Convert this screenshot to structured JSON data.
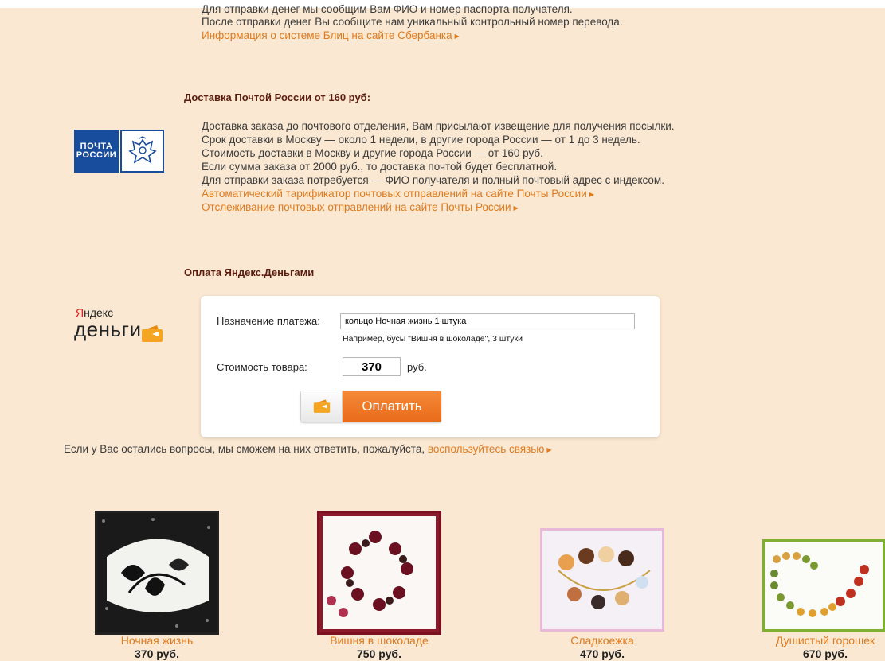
{
  "blitz": {
    "line1": "Для отправки денег мы сообщим Вам ФИО и номер паспорта получателя.",
    "line2": "После отправки денег Вы сообщите нам уникальный контрольный номер перевода.",
    "link": "Информация о системе Блиц на сайте Сбербанка"
  },
  "post": {
    "title": "Доставка Почтой России от 160 руб:",
    "logo_line1": "ПОЧТА",
    "logo_line2": "РОССИИ",
    "lines": [
      "Доставка заказа до почтового отделения, Вам присылают извещение для получения посылки.",
      "Срок доставки в Москву — около 1 недели, в другие города России — от 1 до 3 недель.",
      "Стоимость доставки в Москву и другие города России — от 160 руб.",
      "Если сумма заказа от 2000 руб., то доставка почтой будет бесплатной.",
      "Для отправки заказа потребуется — ФИО получателя и полный почтовый адрес с индексом."
    ],
    "link1": "Автоматический тарификатор почтовых отправлений на сайте Почты России",
    "link2": "Отслеживание почтовых отправлений на сайте Почты России"
  },
  "yandex": {
    "title": "Оплата Яндекс.Деньгами",
    "logo_y": "Я",
    "logo_rest": "ндекс",
    "logo_money": "деньги",
    "purpose_label": "Назначение платежа:",
    "purpose_value": "кольцо Ночная жизнь 1 штука",
    "purpose_hint": "Например, бусы \"Вишня в шоколаде\", 3 штуки",
    "cost_label": "Стоимость товара:",
    "cost_value": "370",
    "currency": "руб.",
    "pay_button": "Оплатить"
  },
  "questions": {
    "text": "Если у Вас остались вопросы, мы сможем на них ответить, пожалуйста,",
    "link": "воспользуйтесь связью"
  },
  "products": [
    {
      "name": "Ночная жизнь",
      "price": "370 руб."
    },
    {
      "name": "Вишня в шоколаде",
      "price": "750 руб."
    },
    {
      "name": "Сладкоежка",
      "price": "470 руб."
    },
    {
      "name": "Душистый горошек",
      "price": "670 руб."
    }
  ],
  "colors": {
    "background": "#fae8d2",
    "link": "#e07a1c",
    "heading": "#5c1b0e",
    "pay_button": "#ef7a26",
    "pochta_blue": "#184c9c"
  }
}
